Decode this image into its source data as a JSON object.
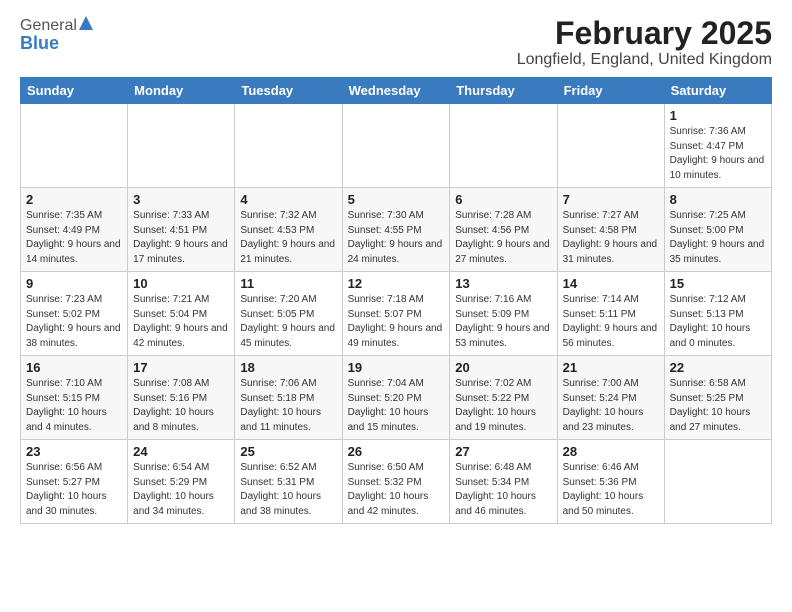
{
  "logo": {
    "general": "General",
    "blue": "Blue"
  },
  "header": {
    "title": "February 2025",
    "subtitle": "Longfield, England, United Kingdom"
  },
  "weekdays": [
    "Sunday",
    "Monday",
    "Tuesday",
    "Wednesday",
    "Thursday",
    "Friday",
    "Saturday"
  ],
  "weeks": [
    [
      {
        "day": "",
        "info": ""
      },
      {
        "day": "",
        "info": ""
      },
      {
        "day": "",
        "info": ""
      },
      {
        "day": "",
        "info": ""
      },
      {
        "day": "",
        "info": ""
      },
      {
        "day": "",
        "info": ""
      },
      {
        "day": "1",
        "info": "Sunrise: 7:36 AM\nSunset: 4:47 PM\nDaylight: 9 hours and 10 minutes."
      }
    ],
    [
      {
        "day": "2",
        "info": "Sunrise: 7:35 AM\nSunset: 4:49 PM\nDaylight: 9 hours and 14 minutes."
      },
      {
        "day": "3",
        "info": "Sunrise: 7:33 AM\nSunset: 4:51 PM\nDaylight: 9 hours and 17 minutes."
      },
      {
        "day": "4",
        "info": "Sunrise: 7:32 AM\nSunset: 4:53 PM\nDaylight: 9 hours and 21 minutes."
      },
      {
        "day": "5",
        "info": "Sunrise: 7:30 AM\nSunset: 4:55 PM\nDaylight: 9 hours and 24 minutes."
      },
      {
        "day": "6",
        "info": "Sunrise: 7:28 AM\nSunset: 4:56 PM\nDaylight: 9 hours and 27 minutes."
      },
      {
        "day": "7",
        "info": "Sunrise: 7:27 AM\nSunset: 4:58 PM\nDaylight: 9 hours and 31 minutes."
      },
      {
        "day": "8",
        "info": "Sunrise: 7:25 AM\nSunset: 5:00 PM\nDaylight: 9 hours and 35 minutes."
      }
    ],
    [
      {
        "day": "9",
        "info": "Sunrise: 7:23 AM\nSunset: 5:02 PM\nDaylight: 9 hours and 38 minutes."
      },
      {
        "day": "10",
        "info": "Sunrise: 7:21 AM\nSunset: 5:04 PM\nDaylight: 9 hours and 42 minutes."
      },
      {
        "day": "11",
        "info": "Sunrise: 7:20 AM\nSunset: 5:05 PM\nDaylight: 9 hours and 45 minutes."
      },
      {
        "day": "12",
        "info": "Sunrise: 7:18 AM\nSunset: 5:07 PM\nDaylight: 9 hours and 49 minutes."
      },
      {
        "day": "13",
        "info": "Sunrise: 7:16 AM\nSunset: 5:09 PM\nDaylight: 9 hours and 53 minutes."
      },
      {
        "day": "14",
        "info": "Sunrise: 7:14 AM\nSunset: 5:11 PM\nDaylight: 9 hours and 56 minutes."
      },
      {
        "day": "15",
        "info": "Sunrise: 7:12 AM\nSunset: 5:13 PM\nDaylight: 10 hours and 0 minutes."
      }
    ],
    [
      {
        "day": "16",
        "info": "Sunrise: 7:10 AM\nSunset: 5:15 PM\nDaylight: 10 hours and 4 minutes."
      },
      {
        "day": "17",
        "info": "Sunrise: 7:08 AM\nSunset: 5:16 PM\nDaylight: 10 hours and 8 minutes."
      },
      {
        "day": "18",
        "info": "Sunrise: 7:06 AM\nSunset: 5:18 PM\nDaylight: 10 hours and 11 minutes."
      },
      {
        "day": "19",
        "info": "Sunrise: 7:04 AM\nSunset: 5:20 PM\nDaylight: 10 hours and 15 minutes."
      },
      {
        "day": "20",
        "info": "Sunrise: 7:02 AM\nSunset: 5:22 PM\nDaylight: 10 hours and 19 minutes."
      },
      {
        "day": "21",
        "info": "Sunrise: 7:00 AM\nSunset: 5:24 PM\nDaylight: 10 hours and 23 minutes."
      },
      {
        "day": "22",
        "info": "Sunrise: 6:58 AM\nSunset: 5:25 PM\nDaylight: 10 hours and 27 minutes."
      }
    ],
    [
      {
        "day": "23",
        "info": "Sunrise: 6:56 AM\nSunset: 5:27 PM\nDaylight: 10 hours and 30 minutes."
      },
      {
        "day": "24",
        "info": "Sunrise: 6:54 AM\nSunset: 5:29 PM\nDaylight: 10 hours and 34 minutes."
      },
      {
        "day": "25",
        "info": "Sunrise: 6:52 AM\nSunset: 5:31 PM\nDaylight: 10 hours and 38 minutes."
      },
      {
        "day": "26",
        "info": "Sunrise: 6:50 AM\nSunset: 5:32 PM\nDaylight: 10 hours and 42 minutes."
      },
      {
        "day": "27",
        "info": "Sunrise: 6:48 AM\nSunset: 5:34 PM\nDaylight: 10 hours and 46 minutes."
      },
      {
        "day": "28",
        "info": "Sunrise: 6:46 AM\nSunset: 5:36 PM\nDaylight: 10 hours and 50 minutes."
      },
      {
        "day": "",
        "info": ""
      }
    ]
  ]
}
